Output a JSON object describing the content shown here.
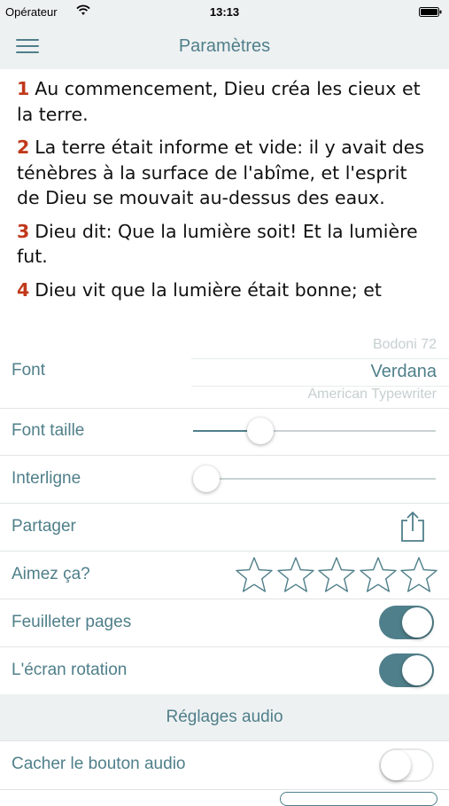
{
  "status_bar": {
    "carrier": "Opérateur",
    "time": "13:13"
  },
  "nav": {
    "title": "Paramètres"
  },
  "verses": [
    {
      "num": "1",
      "text": "Au commencement, Dieu créa les cieux et la terre."
    },
    {
      "num": "2",
      "text": "La terre était informe et vide: il y avait des ténèbres à la surface de l'abîme, et l'esprit de Dieu se mouvait au-dessus des eaux."
    },
    {
      "num": "3",
      "text": "Dieu dit: Que la lumière soit! Et la lumière fut."
    },
    {
      "num": "4",
      "text": "Dieu vit que la lumière était bonne; et"
    }
  ],
  "settings": {
    "font": {
      "label": "Font",
      "options_visible": [
        "Bodoni 72",
        "Verdana",
        "American Typewriter"
      ],
      "selected": "Verdana"
    },
    "font_size": {
      "label": "Font taille",
      "value": 0.25
    },
    "line_spacing": {
      "label": "Interligne",
      "value": 0.0
    },
    "share": {
      "label": "Partager",
      "icon": "share-icon"
    },
    "rating": {
      "label": "Aimez ça?",
      "stars": 5,
      "filled": 0,
      "icon": "star-outline-icon"
    },
    "page_flip": {
      "label": "Feuilleter pages",
      "on": true
    },
    "screen_rotation": {
      "label": "L'écran rotation",
      "on": true
    },
    "audio_section": {
      "header": "Réglages audio"
    },
    "hide_audio_button": {
      "label": "Cacher le bouton audio",
      "on": false
    }
  },
  "colors": {
    "accent": "#4f7f8a",
    "verse_number": "#c0391b",
    "bar_background": "#eef1f2"
  }
}
